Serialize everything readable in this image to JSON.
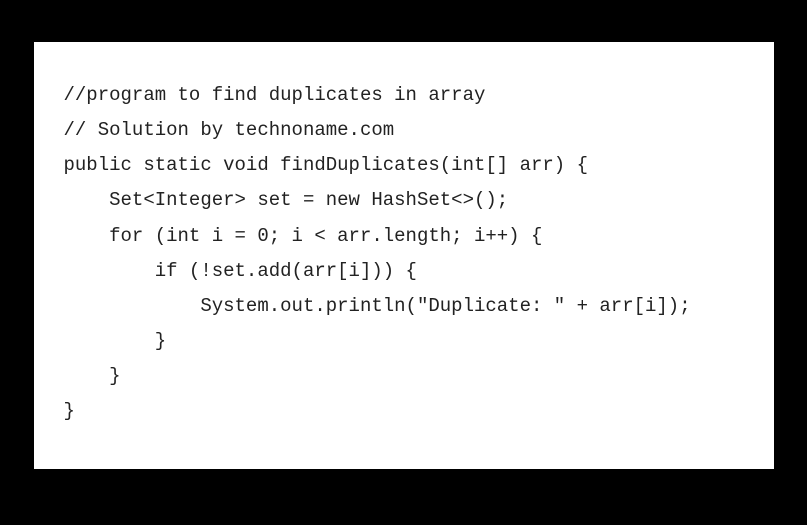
{
  "code": {
    "lines": [
      "//program to find duplicates in array",
      "// Solution by technoname.com",
      "",
      "public static void findDuplicates(int[] arr) {",
      "    Set<Integer> set = new HashSet<>();",
      "    for (int i = 0; i < arr.length; i++) {",
      "        if (!set.add(arr[i])) {",
      "            System.out.println(\"Duplicate: \" + arr[i]);",
      "        }",
      "    }",
      "}"
    ]
  }
}
